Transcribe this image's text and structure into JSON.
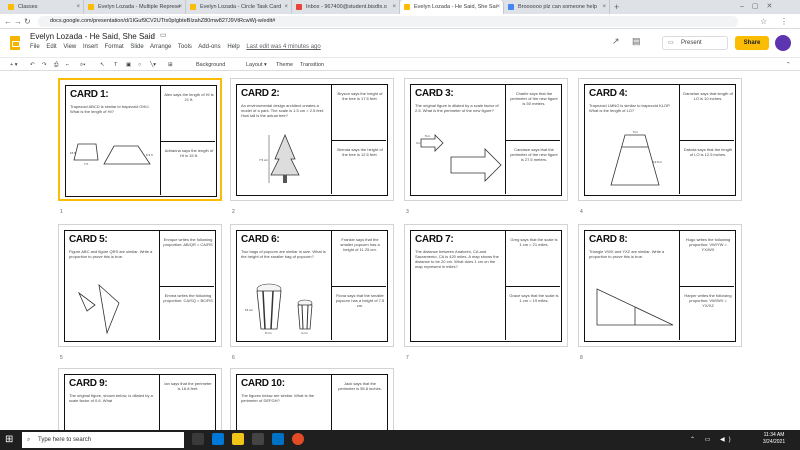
{
  "browser": {
    "tabs": [
      {
        "label": "Classes",
        "color": "#fbbc04",
        "active": false
      },
      {
        "label": "Evelyn Lozada - Multiple Represe",
        "color": "#fbbc04",
        "active": false
      },
      {
        "label": "Evelyn Lozada - Circle Task Card",
        "color": "#fbbc04",
        "active": false
      },
      {
        "label": "Inbox - 967400@student.bisdtx.o",
        "color": "#ea4335",
        "active": false
      },
      {
        "label": "Evelyn Lozada - He Said, She Sai",
        "color": "#fbbc04",
        "active": true
      },
      {
        "label": "Broooooo plz can someone help",
        "color": "#4285f4",
        "active": false
      }
    ],
    "new_tab": "+",
    "url": "docs.google.com/presentation/d/1IGuf9CV2UTtx0pIgbteBIzahZ80mw827J9VtRcwWj-w/edit#"
  },
  "app": {
    "title": "Evelyn Lozada - He Said, She Said",
    "menus": [
      "File",
      "Edit",
      "View",
      "Insert",
      "Format",
      "Slide",
      "Arrange",
      "Tools",
      "Add-ons",
      "Help"
    ],
    "last_edit": "Last edit was 4 minutes ago",
    "present_label": "Present",
    "share_label": "Share"
  },
  "toolbar": {
    "background": "Background",
    "layout": "Layout",
    "theme": "Theme",
    "transition": "Transition"
  },
  "slides": [
    {
      "num": "1",
      "title": "CARD 1:",
      "problem": "Trapezoid ABCD is similar to trapezoid GHIJ. What is the length of HI?",
      "ans1": "Alex says the length of HI is 21 ft.",
      "ans2": "Adrianna says the length of HI is 15 ft.",
      "labels": [
        "15 ft",
        "7 ft",
        "6.3 ft"
      ]
    },
    {
      "num": "2",
      "title": "CARD 2:",
      "problem": "An environmental design architect creates a model of a park. The scale is 1.5 cm = 2.5 feet. How tall is the actual tree?",
      "ans1": "Bryson says the height of the tree is 17.5 feet.",
      "ans2": "Brenda says the height of the tree is 12.5 feet.",
      "labels": [
        "7.5 cm"
      ]
    },
    {
      "num": "3",
      "title": "CARD 3:",
      "problem": "The original figure is dilated by a scale factor of 2.5. What is the perimeter of the new figure?",
      "ans1": "Charlie says that the perimeter of the new figure is 50 meters.",
      "ans2": "Candace says that the perimeter of the new figure is 27.5 meters.",
      "labels": [
        "5 m",
        "3 m"
      ]
    },
    {
      "num": "4",
      "title": "CARD 4:",
      "problem": "Trapezoid LMNO is similar to trapezoid KLOP. What is the length of LO?",
      "ans1": "Damelan says that length of LO is 10 inches.",
      "ans2": "Dakota says that the length of LO is 12.5 inches.",
      "labels": [
        "5 in",
        "12.5 in"
      ]
    },
    {
      "num": "5",
      "title": "CARD 5:",
      "problem": "Figure ABC and figure QRS are similar. Write a proportion to prove this is true.",
      "ans1": "Enrique writes the following proportion: AB/QR = CA/RS",
      "ans2": "Emma writes the following proportion: CA/SQ = BC/RS",
      "labels": []
    },
    {
      "num": "6",
      "title": "CARD 6:",
      "problem": "Two bags of popcorn are similar in size. What is the height of the smaller bag of popcorn?",
      "ans1": "Frankie says that the smaller popcorn has a height of 11.25 cm.",
      "ans2": "Fiona says that the smaller popcorn has a height of 7.5 cm.",
      "labels": [
        "15 cm",
        "8 cm",
        "4 cm"
      ]
    },
    {
      "num": "7",
      "title": "CARD 7:",
      "problem": "The distance between Anaheim, CA and Sacramento, CA is 420 miles. A map shows the distance to be 20 cm. What does 1 cm on the map represent in miles?",
      "ans1": "Greg says that the scale is 1 cm = 21 miles.",
      "ans2": "Grace says that the scale is 1 cm = 19 miles.",
      "labels": []
    },
    {
      "num": "8",
      "title": "CARD 8:",
      "problem": "Triangle VWX and YXZ are similar. Write a proportion to prove this is true.",
      "ans1": "Hugo writes the following proportion: VW/YW = YX/WX",
      "ans2": "Harper writes the following proportion: VW/WX = YX/XZ",
      "labels": []
    },
    {
      "num": "9",
      "title": "CARD 9:",
      "problem": "The original figure, shown below, is dilated by a scale factor of 0.6. What",
      "ans1": "Ian says that the perimeter is 16.8 feet.",
      "ans2": "",
      "labels": []
    },
    {
      "num": "10",
      "title": "CARD 10:",
      "problem": "The figures below are similar. What is the perimeter of DEFGH?",
      "ans1": "Jack says that the perimeter is 55.8 inches.",
      "ans2": "",
      "labels": []
    }
  ],
  "taskbar": {
    "search_placeholder": "Type here to search",
    "time": "11:34 AM",
    "date": "3/24/2021"
  }
}
